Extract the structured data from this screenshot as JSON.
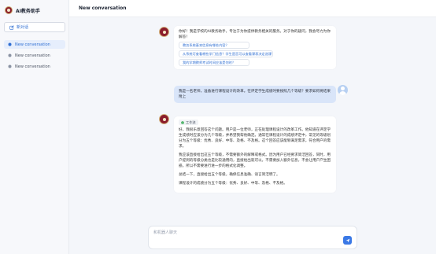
{
  "app": {
    "title": "AI教务助手"
  },
  "sidebar": {
    "new_chat_label": "新对话",
    "items": [
      {
        "label": "New conversation",
        "active": true
      },
      {
        "label": "New conversation",
        "active": false
      },
      {
        "label": "New conversation",
        "active": false
      }
    ]
  },
  "header": {
    "title": "New conversation"
  },
  "messages": {
    "welcome": {
      "text": "你好！我是学校的AI教务助手，专注于为你提供教务相关的服务。对于你的疑问，我会尽力为你解答！",
      "suggestions": [
        "教务系统基本信息有哪些内容？",
        "从系统可查看哪些学门信息？学生是否可以查看课表决定选课？",
        "我的学期教师考试时间应该是何时？"
      ]
    },
    "user": {
      "text": "我是一名老师，准备进行课程设计的改革。在评定学生成绩时要按照几个等级？要求如何将结果附上"
    },
    "answer": {
      "thinking_label": "工作流",
      "paragraphs": [
        "好，我很乐意回答这个问题。用户是一位老师，正在处理课程设计的改革工作。他知道在评定学生成绩时应该分为几个等级，并希望我帮他确定。通常在课程设计的成绩评定中，常见的等级划分为五个等级：优秀、良好、中等、及格、不及格。这个回答应该能够满足需求，符合用户的需求。",
        "我应该直接给出这五个等级，不需要额外的解释或格式。因为用户已经要求简洁回答，同时，用户提到的等级分类也是比较通用的，直接给出就可以，不需要加入额外信息，不会让用户产生困惑。所以不需要进行进一步的格式化调整。",
        "总结一下，直接给出五个等级，确保信息准确、语言简洁明了。",
        "课程设计的成绩分为五个等级：优秀、良好、中等、及格、不及格。"
      ]
    }
  },
  "composer": {
    "placeholder": "和机器人聊天"
  },
  "colors": {
    "accent": "#3b79e6",
    "brand": "#8b1d2c",
    "user_bubble": "#d9e5f9"
  },
  "icons": {
    "new_chat": "edit-icon",
    "conversation": "chat-bubble-icon",
    "send": "send-arrow-icon",
    "thinking": "check-circle-icon"
  }
}
